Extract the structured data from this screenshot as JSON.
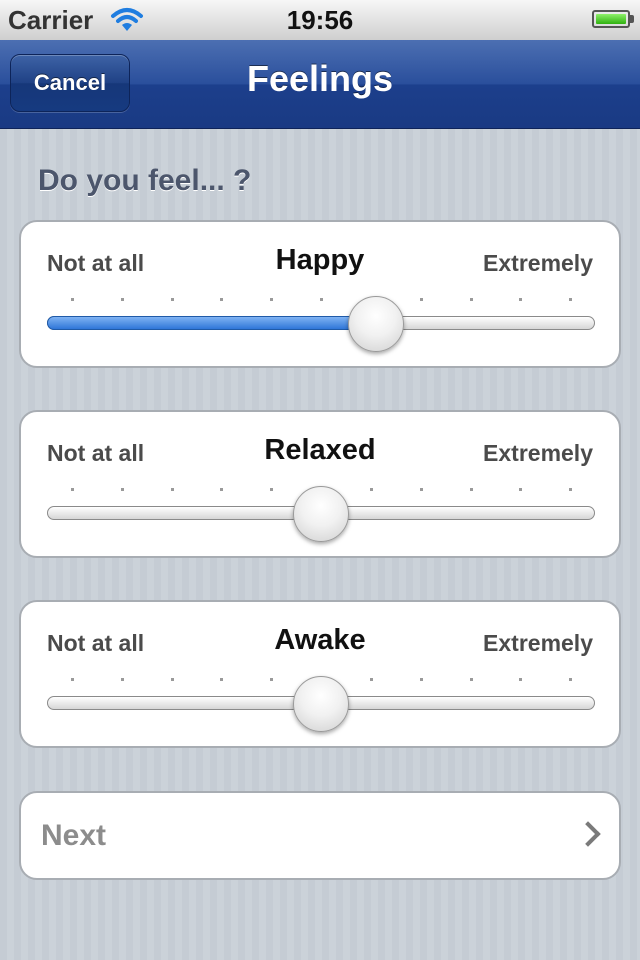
{
  "status_bar": {
    "carrier": "Carrier",
    "time": "19:56"
  },
  "nav": {
    "cancel_label": "Cancel",
    "title": "Feelings"
  },
  "question": "Do you feel... ?",
  "sliders": [
    {
      "title": "Happy",
      "min_label": "Not at all",
      "max_label": "Extremely",
      "value": 0.6
    },
    {
      "title": "Relaxed",
      "min_label": "Not at all",
      "max_label": "Extremely",
      "value": 0.5
    },
    {
      "title": "Awake",
      "min_label": "Not at all",
      "max_label": "Extremely",
      "value": 0.5
    }
  ],
  "next": {
    "label": "Next"
  },
  "colors": {
    "nav_bar": "#1c3f8c",
    "slider_fill": "#2f76d8",
    "background": "#c5ccd4"
  }
}
